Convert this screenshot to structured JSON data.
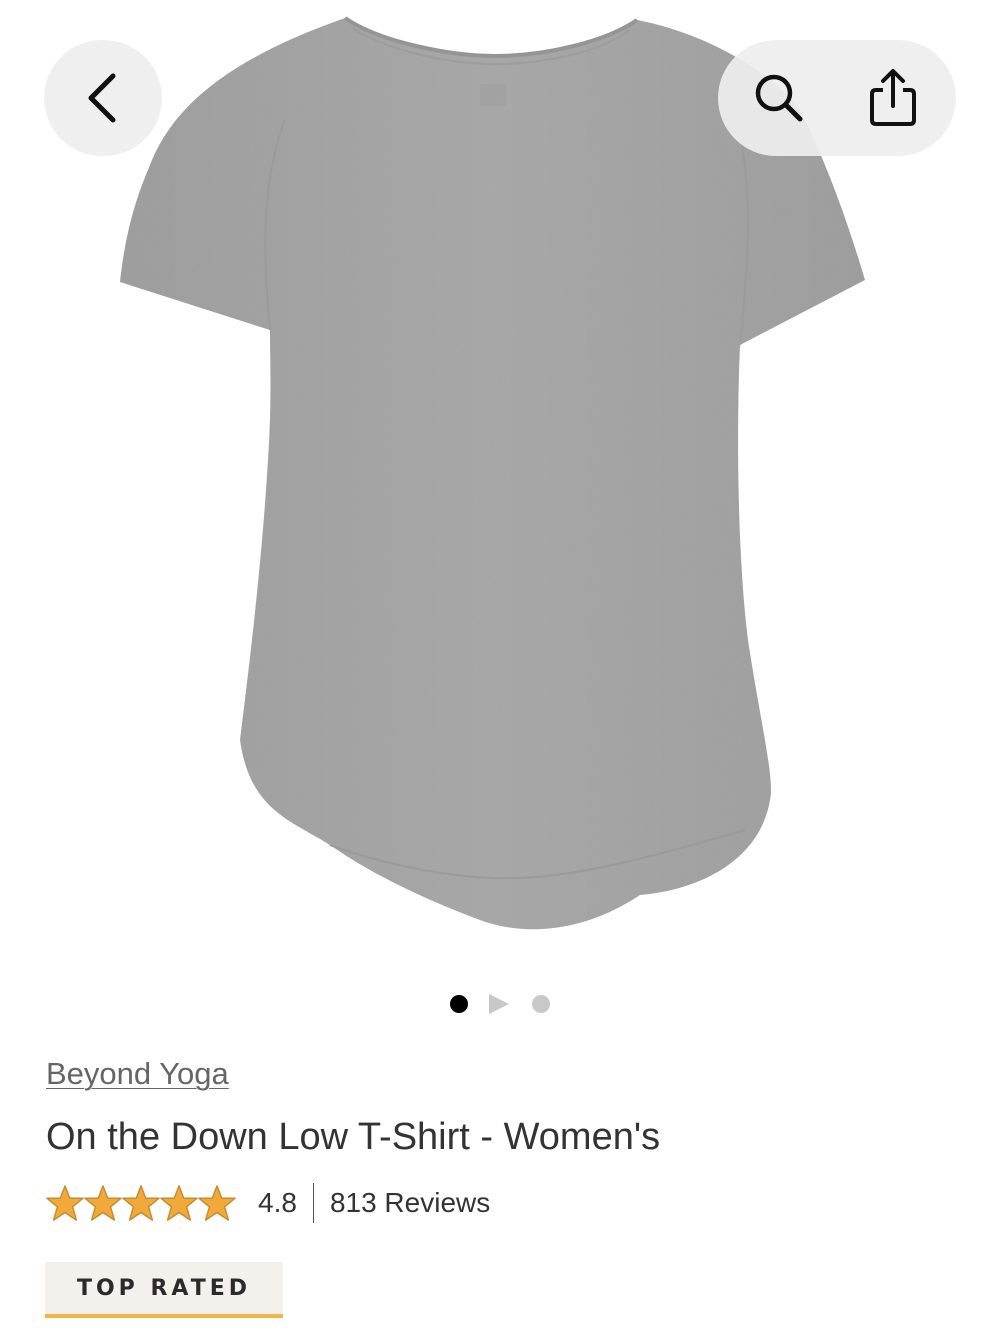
{
  "product": {
    "brand": "Beyond Yoga",
    "title": "On the Down Low T-Shirt - Women's",
    "rating": "4.8",
    "rating_fraction_of_5": 0.96,
    "stars_filled": 5,
    "reviews": "813 Reviews",
    "badge": "TOP RATED",
    "shirt_color": "#a6a6a6",
    "accent_color": "#f1b64b",
    "star_color": "#f2a93b"
  },
  "carousel": {
    "total_items": 3,
    "active_index": 0,
    "items": [
      "image",
      "video",
      "image"
    ]
  },
  "toolbar": {
    "back_icon": "chevron-left-icon",
    "search_icon": "search-icon",
    "share_icon": "share-icon"
  }
}
